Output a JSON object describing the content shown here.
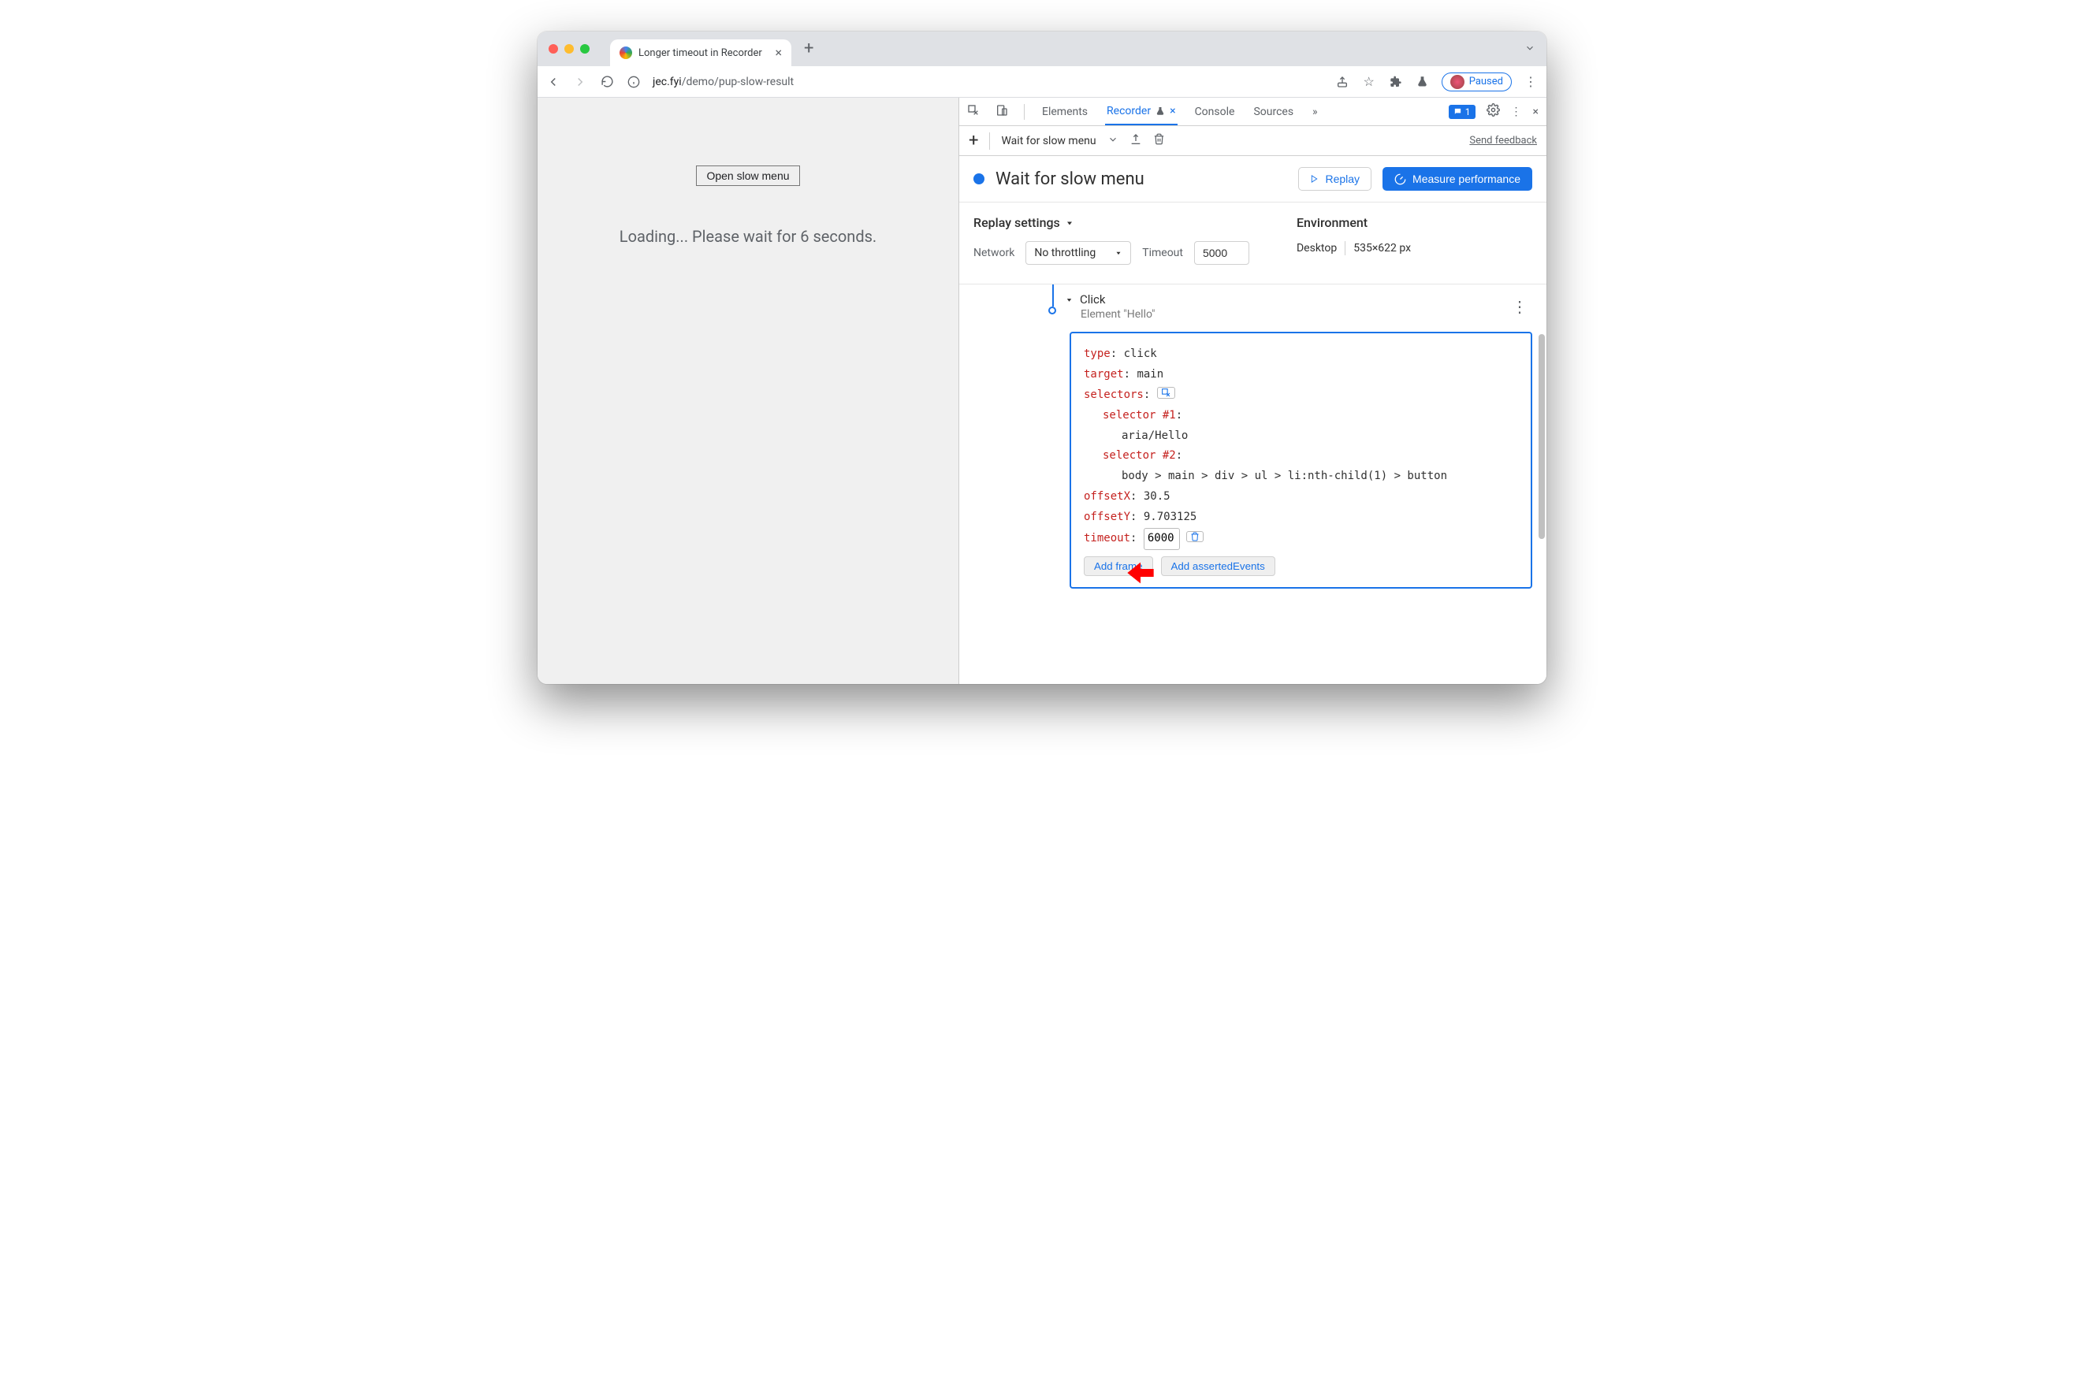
{
  "browser": {
    "tab_title": "Longer timeout in Recorder",
    "url_display_prefix": "jec.fyi",
    "url_display_suffix": "/demo/pup-slow-result",
    "paused_label": "Paused"
  },
  "page": {
    "button_label": "Open slow menu",
    "loading_text": "Loading... Please wait for 6 seconds."
  },
  "devtools": {
    "tabs": {
      "elements": "Elements",
      "recorder": "Recorder",
      "console": "Console",
      "sources": "Sources"
    },
    "issues_count": "1",
    "recorder_toolbar": {
      "recording_name": "Wait for slow menu",
      "feedback": "Send feedback"
    },
    "header": {
      "title": "Wait for slow menu",
      "replay": "Replay",
      "measure": "Measure performance"
    },
    "settings": {
      "heading": "Replay settings",
      "network_label": "Network",
      "network_value": "No throttling",
      "timeout_label": "Timeout",
      "timeout_value": "5000",
      "env_heading": "Environment",
      "device": "Desktop",
      "dims": "535×622 px"
    },
    "step": {
      "title": "Click",
      "subtitle": "Element \"Hello\"",
      "fields": {
        "type_key": "type",
        "type_val": "click",
        "target_key": "target",
        "target_val": "main",
        "selectors_key": "selectors",
        "sel1_key": "selector #1",
        "sel1_val": "aria/Hello",
        "sel2_key": "selector #2",
        "sel2_val": "body > main > div > ul > li:nth-child(1) > button",
        "offx_key": "offsetX",
        "offx_val": "30.5",
        "offy_key": "offsetY",
        "offy_val": "9.703125",
        "timeout_key": "timeout",
        "timeout_val": "6000"
      },
      "add_frame": "Add frame",
      "add_asserted": "Add assertedEvents"
    }
  }
}
